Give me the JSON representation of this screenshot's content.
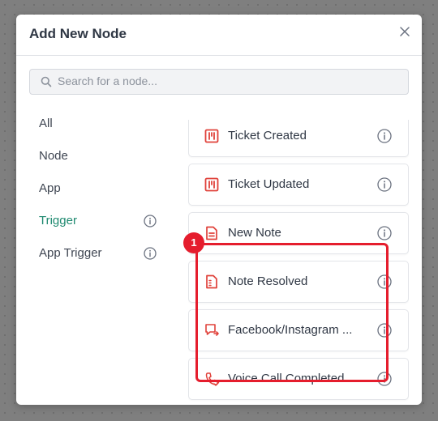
{
  "dialog": {
    "title": "Add New Node"
  },
  "search": {
    "placeholder": "Search for a node..."
  },
  "sidebar": {
    "items": [
      {
        "label": "All"
      },
      {
        "label": "Node"
      },
      {
        "label": "App"
      },
      {
        "label": "Trigger",
        "active": true
      },
      {
        "label": "App Trigger"
      }
    ]
  },
  "nodes": [
    {
      "label": "Ticket Created",
      "icon": "ticket-icon"
    },
    {
      "label": "Ticket Updated",
      "icon": "ticket-icon"
    },
    {
      "label": "New Note",
      "icon": "note-icon"
    },
    {
      "label": "Note Resolved",
      "icon": "note-resolved-icon"
    },
    {
      "label": "Facebook/Instagram ...",
      "icon": "social-message-icon"
    },
    {
      "label": "Voice Call Completed",
      "icon": "phone-icon"
    }
  ],
  "annotation": {
    "badge": "1"
  },
  "colors": {
    "accent": "#1f8a70",
    "icon_red": "#e0413a",
    "highlight": "#e51d2d"
  }
}
